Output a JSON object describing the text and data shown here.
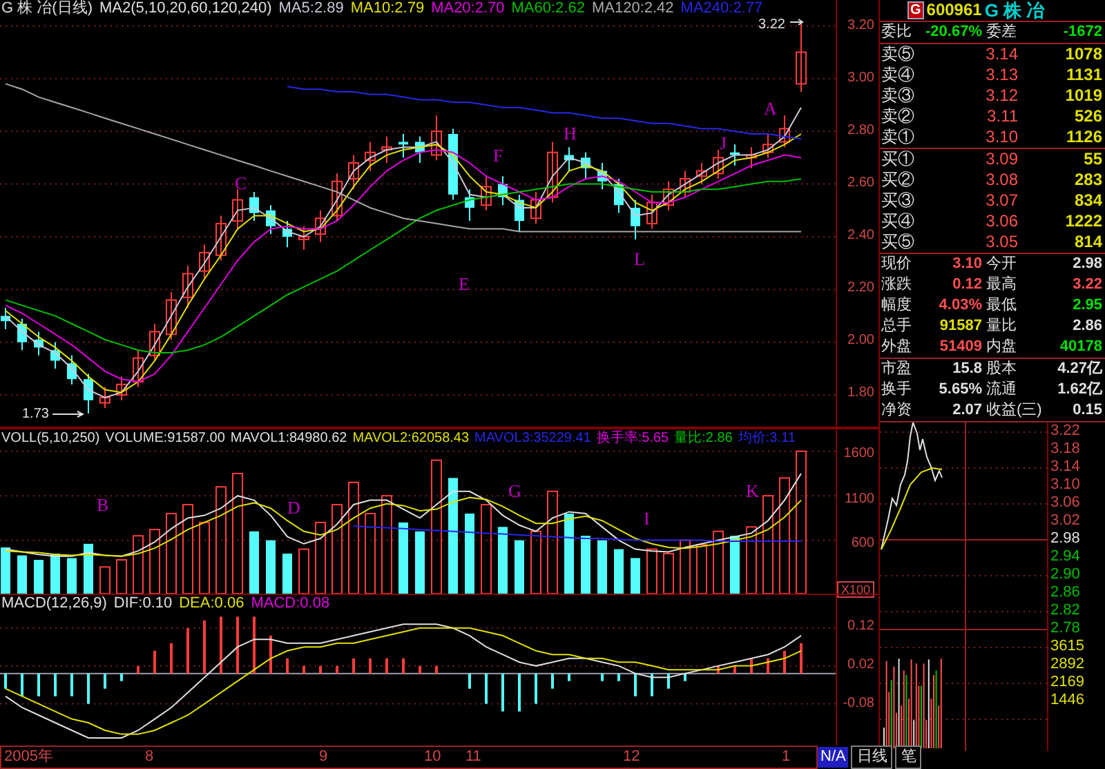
{
  "title": {
    "name": "G 株 冶(日线)",
    "params": "MA2(5,10,20,60,120,240)"
  },
  "ma_legend": [
    {
      "label": "MA5:2.89",
      "color": "#c8c8d8"
    },
    {
      "label": "MA10:2.79",
      "color": "#e0e000"
    },
    {
      "label": "MA20:2.70",
      "color": "#e000e0"
    },
    {
      "label": "MA60:2.62",
      "color": "#00c000"
    },
    {
      "label": "MA120:2.42",
      "color": "#a8a8a8"
    },
    {
      "label": "MA240:2.77",
      "color": "#2828e8"
    }
  ],
  "price_chart": {
    "chart_data": {
      "type": "candlestick",
      "ylim": [
        1.68,
        3.298
      ],
      "grid": true,
      "yticks": [
        {
          "value": 3.2,
          "label": "3.20"
        },
        {
          "value": 3.0,
          "label": "3.00"
        },
        {
          "value": 2.8,
          "label": "2.80"
        },
        {
          "value": 2.6,
          "label": "2.60"
        },
        {
          "value": 2.4,
          "label": "2.40"
        },
        {
          "value": 2.2,
          "label": "2.20"
        },
        {
          "value": 2.0,
          "label": "2.00"
        },
        {
          "value": 1.8,
          "label": "1.80"
        }
      ],
      "ohlc": [
        [
          2.1,
          2.13,
          2.05,
          2.08
        ],
        [
          2.07,
          2.09,
          1.97,
          2.0
        ],
        [
          2.01,
          2.04,
          1.95,
          1.98
        ],
        [
          1.97,
          2.0,
          1.9,
          1.93
        ],
        [
          1.92,
          1.95,
          1.84,
          1.86
        ],
        [
          1.86,
          1.88,
          1.73,
          1.78
        ],
        [
          1.77,
          1.83,
          1.75,
          1.79
        ],
        [
          1.8,
          1.87,
          1.78,
          1.84
        ],
        [
          1.85,
          1.97,
          1.83,
          1.94
        ],
        [
          1.95,
          2.07,
          1.93,
          2.04
        ],
        [
          2.03,
          2.19,
          2.01,
          2.16
        ],
        [
          2.17,
          2.29,
          2.13,
          2.26
        ],
        [
          2.27,
          2.37,
          2.24,
          2.34
        ],
        [
          2.33,
          2.48,
          2.31,
          2.45
        ],
        [
          2.46,
          2.58,
          2.43,
          2.54
        ],
        [
          2.55,
          2.57,
          2.46,
          2.49
        ],
        [
          2.5,
          2.52,
          2.41,
          2.44
        ],
        [
          2.43,
          2.46,
          2.36,
          2.4
        ],
        [
          2.39,
          2.44,
          2.35,
          2.4
        ],
        [
          2.41,
          2.5,
          2.38,
          2.47
        ],
        [
          2.48,
          2.64,
          2.46,
          2.61
        ],
        [
          2.62,
          2.71,
          2.58,
          2.68
        ],
        [
          2.69,
          2.76,
          2.65,
          2.72
        ],
        [
          2.73,
          2.78,
          2.68,
          2.74
        ],
        [
          2.76,
          2.79,
          2.7,
          2.75
        ],
        [
          2.76,
          2.78,
          2.68,
          2.72
        ],
        [
          2.71,
          2.86,
          2.69,
          2.8
        ],
        [
          2.79,
          2.81,
          2.54,
          2.56
        ],
        [
          2.55,
          2.58,
          2.46,
          2.51
        ],
        [
          2.52,
          2.63,
          2.5,
          2.59
        ],
        [
          2.6,
          2.63,
          2.52,
          2.55
        ],
        [
          2.54,
          2.56,
          2.42,
          2.46
        ],
        [
          2.47,
          2.57,
          2.45,
          2.54
        ],
        [
          2.55,
          2.76,
          2.53,
          2.72
        ],
        [
          2.71,
          2.74,
          2.65,
          2.69
        ],
        [
          2.7,
          2.72,
          2.62,
          2.66
        ],
        [
          2.65,
          2.68,
          2.58,
          2.61
        ],
        [
          2.6,
          2.62,
          2.49,
          2.52
        ],
        [
          2.51,
          2.54,
          2.39,
          2.44
        ],
        [
          2.45,
          2.56,
          2.43,
          2.53
        ],
        [
          2.52,
          2.61,
          2.5,
          2.58
        ],
        [
          2.57,
          2.65,
          2.55,
          2.62
        ],
        [
          2.63,
          2.68,
          2.6,
          2.65
        ],
        [
          2.64,
          2.73,
          2.62,
          2.7
        ],
        [
          2.72,
          2.75,
          2.67,
          2.71
        ],
        [
          2.7,
          2.74,
          2.66,
          2.71
        ],
        [
          2.72,
          2.79,
          2.7,
          2.75
        ],
        [
          2.76,
          2.86,
          2.74,
          2.81
        ],
        [
          2.98,
          3.22,
          2.95,
          3.1
        ]
      ],
      "series": [
        {
          "type": "line",
          "color": "#c8c8d8",
          "values": [
            2.1,
            2.04,
            1.99,
            1.96,
            1.9,
            1.82,
            1.79,
            1.81,
            1.89,
            1.99,
            2.1,
            2.21,
            2.3,
            2.4,
            2.5,
            2.51,
            2.47,
            2.42,
            2.4,
            2.44,
            2.54,
            2.65,
            2.7,
            2.73,
            2.74,
            2.74,
            2.76,
            2.68,
            2.56,
            2.55,
            2.56,
            2.51,
            2.51,
            2.63,
            2.7,
            2.68,
            2.64,
            2.57,
            2.48,
            2.49,
            2.56,
            2.6,
            2.64,
            2.68,
            2.71,
            2.71,
            2.73,
            2.78,
            2.89
          ]
        },
        {
          "type": "line",
          "color": "#e0e000",
          "values": [
            2.12,
            2.07,
            2.02,
            1.98,
            1.93,
            1.87,
            1.82,
            1.81,
            1.85,
            1.93,
            2.03,
            2.14,
            2.24,
            2.33,
            2.43,
            2.48,
            2.48,
            2.45,
            2.42,
            2.43,
            2.5,
            2.59,
            2.67,
            2.71,
            2.73,
            2.74,
            2.75,
            2.71,
            2.63,
            2.57,
            2.56,
            2.53,
            2.51,
            2.57,
            2.65,
            2.67,
            2.65,
            2.6,
            2.53,
            2.5,
            2.53,
            2.58,
            2.61,
            2.65,
            2.69,
            2.7,
            2.72,
            2.75,
            2.79
          ]
        },
        {
          "type": "line",
          "color": "#e000e0",
          "values": [
            2.14,
            2.11,
            2.07,
            2.03,
            1.99,
            1.94,
            1.89,
            1.86,
            1.85,
            1.88,
            1.95,
            2.04,
            2.13,
            2.22,
            2.31,
            2.38,
            2.43,
            2.44,
            2.43,
            2.43,
            2.46,
            2.52,
            2.59,
            2.65,
            2.69,
            2.72,
            2.73,
            2.72,
            2.68,
            2.63,
            2.6,
            2.57,
            2.54,
            2.55,
            2.59,
            2.62,
            2.63,
            2.61,
            2.57,
            2.53,
            2.53,
            2.55,
            2.58,
            2.61,
            2.64,
            2.67,
            2.69,
            2.71,
            2.7
          ]
        },
        {
          "type": "line",
          "color": "#00c000",
          "values": [
            2.16,
            2.14,
            2.12,
            2.1,
            2.07,
            2.04,
            2.01,
            1.99,
            1.97,
            1.96,
            1.96,
            1.97,
            1.99,
            2.02,
            2.06,
            2.1,
            2.14,
            2.18,
            2.21,
            2.24,
            2.27,
            2.31,
            2.35,
            2.39,
            2.43,
            2.47,
            2.5,
            2.52,
            2.54,
            2.55,
            2.56,
            2.57,
            2.58,
            2.59,
            2.6,
            2.6,
            2.6,
            2.59,
            2.58,
            2.57,
            2.57,
            2.57,
            2.58,
            2.58,
            2.59,
            2.6,
            2.61,
            2.61,
            2.62
          ]
        },
        {
          "type": "line",
          "color": "#a8a8a8",
          "values": [
            2.98,
            2.96,
            2.93,
            2.91,
            2.89,
            2.87,
            2.85,
            2.83,
            2.81,
            2.79,
            2.77,
            2.75,
            2.73,
            2.71,
            2.69,
            2.67,
            2.65,
            2.63,
            2.61,
            2.59,
            2.57,
            2.54,
            2.51,
            2.49,
            2.47,
            2.46,
            2.45,
            2.44,
            2.43,
            2.43,
            2.43,
            2.42,
            2.42,
            2.42,
            2.42,
            2.42,
            2.42,
            2.42,
            2.42,
            2.42,
            2.42,
            2.42,
            2.42,
            2.42,
            2.42,
            2.42,
            2.42,
            2.42,
            2.42
          ]
        },
        {
          "type": "line",
          "color": "#2828e8",
          "values": [
            null,
            null,
            null,
            null,
            null,
            null,
            null,
            null,
            null,
            null,
            null,
            null,
            null,
            null,
            null,
            null,
            null,
            2.97,
            2.96,
            2.96,
            2.95,
            2.95,
            2.94,
            2.94,
            2.93,
            2.92,
            2.92,
            2.91,
            2.91,
            2.9,
            2.89,
            2.89,
            2.88,
            2.87,
            2.87,
            2.86,
            2.85,
            2.85,
            2.84,
            2.83,
            2.83,
            2.82,
            2.81,
            2.81,
            2.8,
            2.79,
            2.79,
            2.78,
            2.77
          ]
        }
      ]
    }
  },
  "price_markers": [
    "A",
    "C",
    "E",
    "F",
    "H",
    "J",
    "L"
  ],
  "high_label": "3.22",
  "low_label": "1.73",
  "volume_legend": [
    {
      "label": "VOLL(5,10,250)",
      "color": "#e0e0e0"
    },
    {
      "label": "VOLUME:91587.00",
      "color": "#e0e0e0"
    },
    {
      "label": "MAVOL1:84980.62",
      "color": "#e0e0e0"
    },
    {
      "label": "MAVOL2:62058.43",
      "color": "#e0e000"
    },
    {
      "label": "MAVOL3:35229.41",
      "color": "#2828e8"
    },
    {
      "label": "换手率:5.65",
      "color": "#e000e0"
    },
    {
      "label": "量比:2.86",
      "color": "#00c000"
    },
    {
      "label": "均价:3.11",
      "color": "#2828e8"
    }
  ],
  "volume_chart": {
    "chart_data": {
      "type": "bar",
      "ylim": [
        0,
        1846
      ],
      "grid": true,
      "yticks": [
        {
          "value": 1600,
          "label": "1600"
        },
        {
          "value": 1100,
          "label": "1100"
        },
        {
          "value": 600,
          "label": "600"
        }
      ],
      "series": [
        {
          "type": "bar",
          "colors": [
            "#54fcfc",
            "#54fcfc",
            "#54fcfc",
            "#54fcfc",
            "#54fcfc",
            "#54fcfc",
            "#ff3c3c",
            "#ff3c3c",
            "#ff3c3c",
            "#ff3c3c",
            "#ff3c3c",
            "#ff3c3c",
            "#ff3c3c",
            "#ff3c3c",
            "#ff3c3c",
            "#54fcfc",
            "#54fcfc",
            "#54fcfc",
            "#ff3c3c",
            "#ff3c3c",
            "#ff3c3c",
            "#ff3c3c",
            "#ff3c3c",
            "#ff3c3c",
            "#54fcfc",
            "#54fcfc",
            "#ff3c3c",
            "#54fcfc",
            "#54fcfc",
            "#ff3c3c",
            "#54fcfc",
            "#54fcfc",
            "#ff3c3c",
            "#ff3c3c",
            "#54fcfc",
            "#54fcfc",
            "#54fcfc",
            "#54fcfc",
            "#54fcfc",
            "#ff3c3c",
            "#ff3c3c",
            "#ff3c3c",
            "#ff3c3c",
            "#ff3c3c",
            "#54fcfc",
            "#ff3c3c",
            "#ff3c3c",
            "#ff3c3c",
            "#ff3c3c"
          ],
          "values": [
            520,
            430,
            380,
            450,
            400,
            560,
            300,
            380,
            650,
            720,
            900,
            1000,
            800,
            1200,
            1350,
            700,
            600,
            450,
            500,
            800,
            1000,
            1250,
            900,
            1100,
            800,
            700,
            1500,
            1300,
            900,
            1000,
            750,
            600,
            700,
            1150,
            900,
            650,
            600,
            500,
            400,
            500,
            450,
            600,
            550,
            700,
            650,
            750,
            1100,
            1300,
            1600
          ]
        },
        {
          "type": "line",
          "color": "#e0e0e0",
          "values": [
            500,
            470,
            440,
            420,
            420,
            460,
            430,
            420,
            480,
            580,
            730,
            850,
            880,
            960,
            1100,
            1050,
            880,
            640,
            560,
            620,
            780,
            1000,
            1050,
            1050,
            950,
            850,
            1000,
            1150,
            1150,
            1050,
            880,
            770,
            700,
            850,
            920,
            900,
            750,
            600,
            500,
            480,
            470,
            520,
            560,
            600,
            640,
            680,
            820,
            1050,
            1350
          ]
        },
        {
          "type": "line",
          "color": "#e0e000",
          "values": [
            480,
            470,
            460,
            440,
            430,
            440,
            430,
            420,
            450,
            510,
            610,
            720,
            800,
            880,
            980,
            1020,
            960,
            820,
            700,
            660,
            720,
            850,
            960,
            1010,
            990,
            930,
            950,
            1030,
            1080,
            1060,
            980,
            880,
            790,
            790,
            840,
            870,
            820,
            720,
            620,
            560,
            520,
            510,
            530,
            560,
            600,
            640,
            720,
            860,
            1050
          ]
        },
        {
          "type": "line",
          "color": "#2828e8",
          "values": [
            null,
            null,
            null,
            null,
            null,
            null,
            null,
            null,
            null,
            null,
            null,
            null,
            null,
            null,
            null,
            null,
            null,
            null,
            null,
            null,
            null,
            760,
            750,
            740,
            730,
            720,
            710,
            700,
            690,
            680,
            670,
            660,
            650,
            640,
            630,
            620,
            620,
            610,
            600,
            600,
            600,
            600,
            600,
            590,
            590,
            590,
            590,
            590,
            590
          ]
        }
      ]
    }
  },
  "volume_unit": "X100",
  "volume_markers": [
    "B",
    "D",
    "G",
    "I",
    "K"
  ],
  "macd_legend": [
    {
      "label": "MACD(12,26,9)",
      "color": "#e0e0e0"
    },
    {
      "label": "DIF:0.10",
      "color": "#e0e0e0"
    },
    {
      "label": "DEA:0.06",
      "color": "#e0e000"
    },
    {
      "label": "MACD:0.08",
      "color": "#e000e0"
    }
  ],
  "macd_chart": {
    "chart_data": {
      "type": "line",
      "ylim": [
        -0.19,
        0.207
      ],
      "grid": true,
      "yticks": [
        {
          "value": 0.12,
          "label": "0.12"
        },
        {
          "value": 0.02,
          "label": "0.02"
        },
        {
          "value": -0.08,
          "label": "-0.08"
        }
      ],
      "series": [
        {
          "type": "bar",
          "colors": [
            "#54fcfc",
            "#54fcfc",
            "#54fcfc",
            "#54fcfc",
            "#54fcfc",
            "#54fcfc",
            "#54fcfc",
            "#54fcfc",
            "#ff3c3c",
            "#ff3c3c",
            "#ff3c3c",
            "#ff3c3c",
            "#ff3c3c",
            "#ff3c3c",
            "#ff3c3c",
            "#ff3c3c",
            "#ff3c3c",
            "#ff3c3c",
            "#ff3c3c",
            "#ff3c3c",
            "#ff3c3c",
            "#ff3c3c",
            "#ff3c3c",
            "#ff3c3c",
            "#ff3c3c",
            "#ff3c3c",
            "#ff3c3c",
            "#ff3c3c",
            "#54fcfc",
            "#54fcfc",
            "#54fcfc",
            "#54fcfc",
            "#54fcfc",
            "#54fcfc",
            "#54fcfc",
            "#ff3c3c",
            "#54fcfc",
            "#54fcfc",
            "#54fcfc",
            "#54fcfc",
            "#54fcfc",
            "#54fcfc",
            "#ff3c3c",
            "#ff3c3c",
            "#ff3c3c",
            "#ff3c3c",
            "#ff3c3c",
            "#ff3c3c",
            "#ff3c3c"
          ],
          "values": [
            -0.04,
            -0.06,
            -0.06,
            -0.06,
            -0.06,
            -0.08,
            -0.04,
            -0.02,
            0.02,
            0.06,
            0.08,
            0.12,
            0.14,
            0.15,
            0.15,
            0.15,
            0.1,
            0.04,
            0.02,
            0.02,
            0.02,
            0.04,
            0.04,
            0.04,
            0.04,
            0.02,
            0.02,
            0.0,
            -0.04,
            -0.08,
            -0.1,
            -0.1,
            -0.08,
            -0.04,
            -0.02,
            0.0,
            -0.02,
            -0.02,
            -0.06,
            -0.06,
            -0.04,
            -0.02,
            0.0,
            0.02,
            0.02,
            0.04,
            0.04,
            0.06,
            0.08
          ]
        },
        {
          "type": "line",
          "color": "#e0e0e0",
          "values": [
            -0.06,
            -0.09,
            -0.11,
            -0.13,
            -0.15,
            -0.17,
            -0.17,
            -0.17,
            -0.15,
            -0.12,
            -0.09,
            -0.05,
            -0.01,
            0.03,
            0.07,
            0.09,
            0.09,
            0.08,
            0.08,
            0.08,
            0.09,
            0.1,
            0.11,
            0.12,
            0.13,
            0.13,
            0.13,
            0.12,
            0.1,
            0.07,
            0.05,
            0.03,
            0.02,
            0.03,
            0.04,
            0.04,
            0.03,
            0.02,
            0.0,
            -0.01,
            -0.01,
            0.0,
            0.01,
            0.02,
            0.03,
            0.04,
            0.05,
            0.07,
            0.1
          ]
        },
        {
          "type": "line",
          "color": "#e0e000",
          "values": [
            -0.04,
            -0.06,
            -0.08,
            -0.1,
            -0.12,
            -0.13,
            -0.15,
            -0.16,
            -0.16,
            -0.15,
            -0.13,
            -0.11,
            -0.08,
            -0.05,
            -0.02,
            0.01,
            0.04,
            0.06,
            0.07,
            0.07,
            0.08,
            0.08,
            0.09,
            0.1,
            0.11,
            0.12,
            0.12,
            0.12,
            0.12,
            0.11,
            0.1,
            0.08,
            0.06,
            0.05,
            0.05,
            0.04,
            0.04,
            0.03,
            0.03,
            0.02,
            0.01,
            0.01,
            0.01,
            0.01,
            0.02,
            0.02,
            0.03,
            0.04,
            0.06
          ]
        }
      ]
    }
  },
  "dates": [
    "2005年",
    "8",
    "9",
    "10",
    "11",
    "12",
    "1"
  ],
  "date_status": "N/A",
  "period_tabs": [
    "日线",
    "笔"
  ],
  "quote": {
    "badge": "G",
    "code": "600961",
    "name": "G 株 冶",
    "ratio": [
      {
        "label": "委比",
        "value": "-20.67%"
      },
      {
        "label": "委差",
        "value": "-1672"
      }
    ],
    "asks": [
      {
        "label": "卖⑤",
        "price": "3.14",
        "volume": "1078"
      },
      {
        "label": "卖④",
        "price": "3.13",
        "volume": "1131"
      },
      {
        "label": "卖③",
        "price": "3.12",
        "volume": "1019"
      },
      {
        "label": "卖②",
        "price": "3.11",
        "volume": "526"
      },
      {
        "label": "卖①",
        "price": "3.10",
        "volume": "1126"
      }
    ],
    "bids": [
      {
        "label": "买①",
        "price": "3.09",
        "volume": "55"
      },
      {
        "label": "买②",
        "price": "3.08",
        "volume": "283"
      },
      {
        "label": "买③",
        "price": "3.07",
        "volume": "834"
      },
      {
        "label": "买④",
        "price": "3.06",
        "volume": "1222"
      },
      {
        "label": "买⑤",
        "price": "3.05",
        "volume": "814"
      }
    ],
    "stats": [
      {
        "label": "现价",
        "value": "3.10",
        "color": "#ff5050"
      },
      {
        "label": "今开",
        "value": "2.98",
        "color": "#e0e0e0"
      },
      {
        "label": "涨跌",
        "value": "0.12",
        "color": "#ff5050"
      },
      {
        "label": "最高",
        "value": "3.22",
        "color": "#ff5050"
      },
      {
        "label": "幅度",
        "value": "4.03%",
        "color": "#ff5050"
      },
      {
        "label": "最低",
        "value": "2.95",
        "color": "#00e000"
      },
      {
        "label": "总手",
        "value": "91587",
        "color": "#e0e000"
      },
      {
        "label": "量比",
        "value": "2.86",
        "color": "#e0e0e0"
      },
      {
        "label": "外盘",
        "value": "51409",
        "color": "#ff5050"
      },
      {
        "label": "内盘",
        "value": "40178",
        "color": "#00e000"
      }
    ],
    "fundamentals": [
      {
        "label": "市盈",
        "value": "15.8"
      },
      {
        "label": "股本",
        "value": "4.27亿"
      },
      {
        "label": "换手",
        "value": "5.65%"
      },
      {
        "label": "流通",
        "value": "1.62亿"
      },
      {
        "label": "净资",
        "value": "2.07"
      },
      {
        "label": "收益(三)",
        "value": "0.15"
      }
    ]
  },
  "intraday_axis": [
    {
      "label": "3.22",
      "color": "#d04848"
    },
    {
      "label": "3.18",
      "color": "#d04848"
    },
    {
      "label": "3.14",
      "color": "#d04848"
    },
    {
      "label": "3.10",
      "color": "#d04848"
    },
    {
      "label": "3.06",
      "color": "#d04848"
    },
    {
      "label": "3.02",
      "color": "#d04848"
    },
    {
      "label": "2.98",
      "color": "#e0e0e0"
    },
    {
      "label": "2.94",
      "color": "#00c000"
    },
    {
      "label": "2.90",
      "color": "#00c000"
    },
    {
      "label": "2.86",
      "color": "#00c000"
    },
    {
      "label": "2.82",
      "color": "#00c000"
    },
    {
      "label": "2.78",
      "color": "#00c000"
    },
    {
      "label": "3615",
      "color": "#e0e000"
    },
    {
      "label": "2892",
      "color": "#e0e000"
    },
    {
      "label": "2169",
      "color": "#e0e000"
    },
    {
      "label": "1446",
      "color": "#e0e000"
    }
  ]
}
